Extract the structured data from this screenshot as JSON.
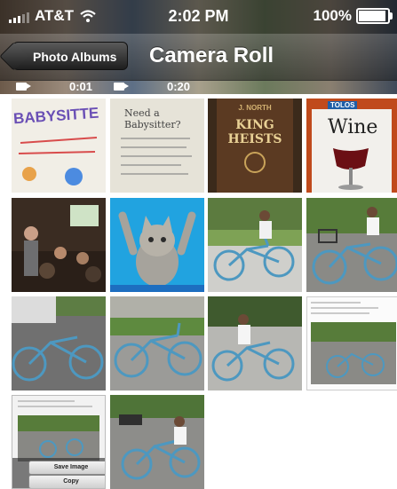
{
  "status_bar": {
    "carrier": "AT&T",
    "time": "2:02 PM",
    "battery": "100%",
    "battery_level": 1.0
  },
  "nav_bar": {
    "back_label": "Photo Albums",
    "title": "Camera Roll"
  },
  "videos": [
    {
      "duration": "0:01"
    },
    {
      "duration": "0:20"
    }
  ],
  "thumbnails": {
    "babysitter": "BABYSITTE",
    "need_babysitter": "Need a Babysitter?",
    "book_title": "KING HEISTS",
    "book_top": "J. NORTH",
    "wine": "Wine",
    "wine_tag": "TOLOS"
  },
  "photo_menu": {
    "save_label": "Save Image",
    "copy_label": "Copy"
  },
  "colors": {
    "bike": "#4d98c0",
    "nav_dark": "#1e1e1e",
    "grass": "#4f8a3a"
  }
}
